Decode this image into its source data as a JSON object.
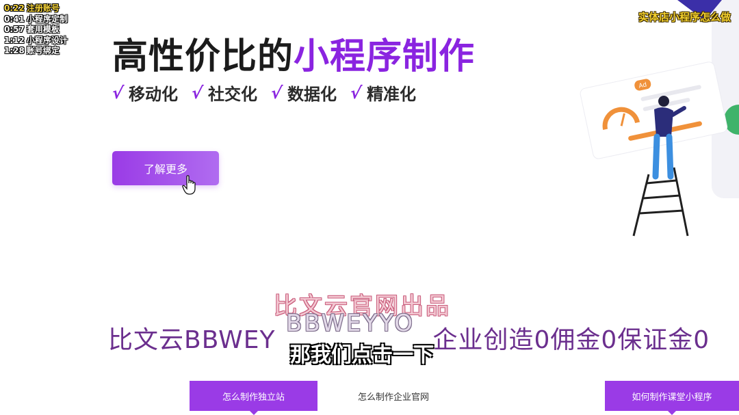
{
  "video_overlay": {
    "chapters": [
      {
        "time": "0:22",
        "label": "注册账号"
      },
      {
        "time": "0:41",
        "label": "小程序定制"
      },
      {
        "time": "0:57",
        "label": "套用模板"
      },
      {
        "time": "1:12",
        "label": "小程序设计"
      },
      {
        "time": "1:28",
        "label": "账号绑定"
      }
    ],
    "channel_title": "实体店小程序怎么做",
    "brand_title": "比文云官网出品",
    "brand_name": "BBWEYYO",
    "subtitle": "那我们点击一下"
  },
  "hero": {
    "title_main": "高性价比的",
    "title_accent": "小程序制作",
    "features": [
      "移动化",
      "社交化",
      "数据化",
      "精准化"
    ],
    "check_glyph": "√",
    "cta_label": "了解更多"
  },
  "illustration": {
    "badge_text": "Ad"
  },
  "tagline": "比文云BBWEY",
  "tagline_tail": "企业创造0佣金0保证金0",
  "tabs": [
    {
      "label": "怎么制作独立站",
      "active": true
    },
    {
      "label": "怎么制作企业官网",
      "active": false
    },
    {
      "label": "如何制作课堂小程序",
      "active": true
    }
  ],
  "colors": {
    "accent": "#8a24e0",
    "button": "#9a3be6",
    "caption_yellow": "#f2cf2e"
  }
}
